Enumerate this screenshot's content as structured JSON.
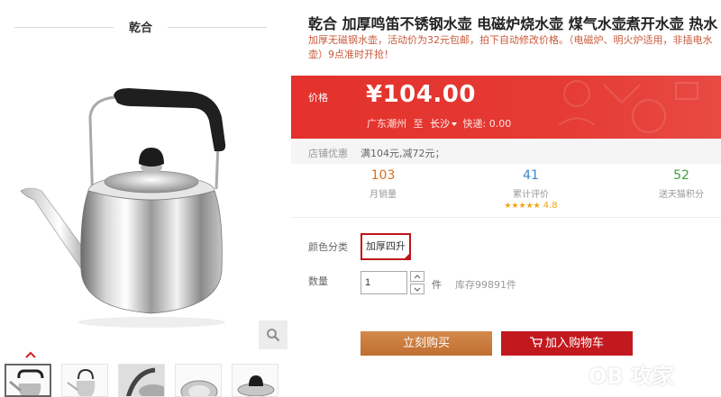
{
  "gallery": {
    "brand": "乾合",
    "thumb_count": 5
  },
  "product": {
    "title": "乾合 加厚鸣笛不锈钢水壶 电磁炉烧水壶 煤气水壶煮开水壶 热水",
    "subtitle": "加厚无磁钢水壶，活动价为32元包邮，拍下自动修改价格。（电磁炉、明火炉适用，非插电水壶）9点准时开抢！",
    "price_label": "价格",
    "price": "¥104.00",
    "ship_from": "广东潮州",
    "ship_to_prefix": "至",
    "ship_to": "长沙",
    "ship_fee": "快递: 0.00"
  },
  "promo": {
    "label": "店铺优惠",
    "text": "满104元,减72元；"
  },
  "stats": {
    "monthly_sales": "103",
    "monthly_sales_label": "月销量",
    "reviews": "41",
    "reviews_label": "累计评价",
    "rating": "4.8",
    "rating_stars": "★★★★★",
    "points": "52",
    "points_label": "送天猫积分"
  },
  "options": {
    "color_label": "颜色分类",
    "color_selected": "加厚四升",
    "qty_label": "数量",
    "qty_value": "1",
    "qty_unit": "件",
    "stock": "库存99891件"
  },
  "actions": {
    "buy_now": "立刻购买",
    "add_to_cart": "加入购物车"
  },
  "watermark": {
    "text": "OB 攻家"
  },
  "colors": {
    "price_bg": "#e4312b",
    "cart_btn": "#c2191f",
    "buy_btn": "#c97b3c",
    "selected_border": "#c0141b"
  }
}
